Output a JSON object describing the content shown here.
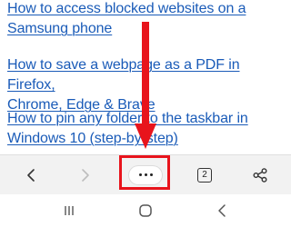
{
  "articles": [
    {
      "title": "How to access blocked websites on a\nSamsung phone"
    },
    {
      "title": "How to save a webpage as a PDF in Firefox,\nChrome, Edge & Brave"
    },
    {
      "title": "How to pin any folder to the taskbar in\nWindows 10 (step-by-step)"
    }
  ],
  "toolbar": {
    "back_icon": "chevron-left-icon",
    "forward_icon": "chevron-right-icon",
    "menu_icon": "more-horizontal-icon",
    "tab_count": "2",
    "share_icon": "share-icon"
  },
  "annotation": {
    "color": "#e8141c"
  },
  "system_nav": {
    "recents_icon": "recents-icon",
    "home_icon": "home-icon",
    "back_icon": "nav-back-icon"
  },
  "colors": {
    "link": "#1a5bb8",
    "toolbar_bg": "#f2f2f2"
  }
}
